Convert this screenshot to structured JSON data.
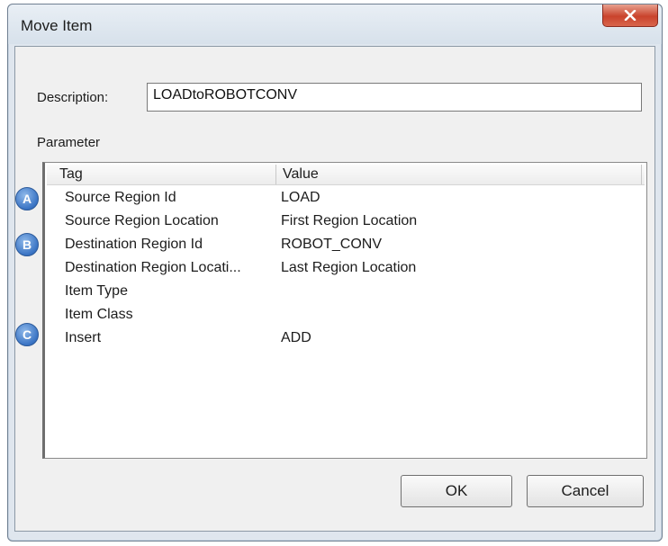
{
  "window": {
    "title": "Move Item",
    "close_icon": "close-x-icon"
  },
  "form": {
    "description_label": "Description:",
    "description_value": "LOADtoROBOTCONV",
    "parameter_label": "Parameter"
  },
  "grid": {
    "columns": [
      "Tag",
      "Value"
    ],
    "rows": [
      {
        "tag": "Source Region Id",
        "value": "LOAD"
      },
      {
        "tag": "Source Region Location",
        "value": "First Region Location"
      },
      {
        "tag": "Destination Region Id",
        "value": "ROBOT_CONV"
      },
      {
        "tag": "Destination Region Locati...",
        "value": "Last Region Location"
      },
      {
        "tag": "Item Type",
        "value": ""
      },
      {
        "tag": "Item Class",
        "value": ""
      },
      {
        "tag": "Insert",
        "value": "ADD"
      }
    ]
  },
  "callouts": [
    "A",
    "B",
    "C"
  ],
  "buttons": {
    "ok": "OK",
    "cancel": "Cancel"
  },
  "colors": {
    "close_button": "#c9432c",
    "callout_blue": "#3a74c4"
  }
}
